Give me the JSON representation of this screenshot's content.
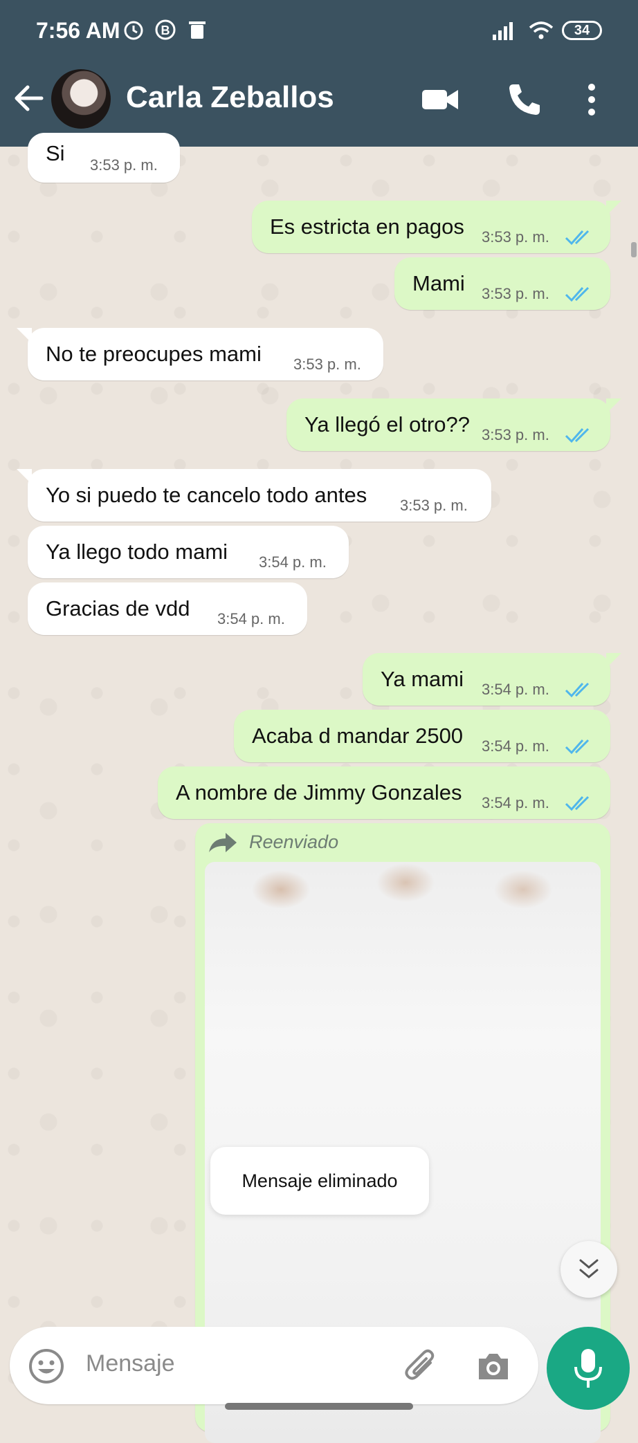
{
  "status_bar": {
    "time": "7:56 AM",
    "battery": "34"
  },
  "header": {
    "contact_name": "Carla Zeballos"
  },
  "messages": [
    {
      "text": "Si",
      "time": "3:53 p. m.",
      "dir": "in"
    },
    {
      "text": "Es estricta en pagos",
      "time": "3:53 p. m.",
      "dir": "out"
    },
    {
      "text": "Mami",
      "time": "3:53 p. m.",
      "dir": "out"
    },
    {
      "text": "No te preocupes mami",
      "time": "3:53 p. m.",
      "dir": "in"
    },
    {
      "text": "Ya llegó el otro??",
      "time": "3:53 p. m.",
      "dir": "out"
    },
    {
      "text": "Yo si puedo te cancelo todo antes",
      "time": "3:53 p. m.",
      "dir": "in"
    },
    {
      "text": "Ya llego todo mami",
      "time": "3:54 p. m.",
      "dir": "in"
    },
    {
      "text": "Gracias de vdd",
      "time": "3:54 p. m.",
      "dir": "in"
    },
    {
      "text": "Ya mami",
      "time": "3:54 p. m.",
      "dir": "out"
    },
    {
      "text": "Acaba d mandar 2500",
      "time": "3:54 p. m.",
      "dir": "out"
    },
    {
      "text": "A nombre de Jimmy Gonzales",
      "time": "3:54 p. m.",
      "dir": "out"
    }
  ],
  "forwarded": {
    "label": "Reenviado"
  },
  "deleted_notice": "Mensaje eliminado",
  "composer": {
    "placeholder": "Mensaje"
  },
  "colors": {
    "header": "#3b5260",
    "outgoing": "#dcf8c6",
    "incoming": "#ffffff",
    "accent": "#1aa884",
    "read_tick": "#4fb6ec"
  },
  "icons": [
    "back-arrow-icon",
    "video-call-icon",
    "phone-icon",
    "more-vert-icon",
    "emoji-icon",
    "attach-icon",
    "camera-icon",
    "mic-icon",
    "forward-icon",
    "double-chevron-down-icon",
    "read-ticks-icon"
  ]
}
